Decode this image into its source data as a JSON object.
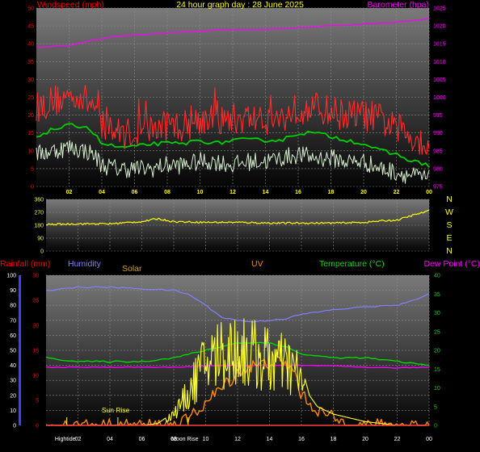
{
  "colors": {
    "wind": "#ff0000",
    "gust": "#ff2a2a",
    "avg": "#00d000",
    "speed": "#d8f0d0",
    "baro": "#ff00ff",
    "dir": "#ffff00",
    "rain": "#ff0000",
    "humidity": "#8080ff",
    "solar": "#ffff30",
    "uv": "#ff8800",
    "temp": "#00e000",
    "dew": "#ff00ff",
    "grid": "#8a8a8a",
    "white_label": "#ffffff",
    "bg_top": "#050505",
    "bg_bottom": "#7a7a7a"
  },
  "chart_data": [
    {
      "type": "line",
      "title": "24 hour graph day : 28 June 2025",
      "left_label": "Windspeed (mph)",
      "right_label": "Barometer (hpa)",
      "x_ticks": [
        "02",
        "04",
        "06",
        "08",
        "10",
        "12",
        "14",
        "16",
        "18",
        "20",
        "22",
        "00"
      ],
      "x_hours": [
        2,
        4,
        6,
        8,
        10,
        12,
        14,
        16,
        18,
        20,
        22,
        24
      ],
      "y_left_ticks": [
        "0",
        "5",
        "10",
        "15",
        "20",
        "25",
        "30",
        "35",
        "40",
        "45",
        "50"
      ],
      "y_left_lim": [
        0,
        50
      ],
      "y_right_ticks": [
        "975",
        "980",
        "985",
        "990",
        "995",
        "1000",
        "1005",
        "1010",
        "1015",
        "1020",
        "1025"
      ],
      "y_right_lim": [
        975,
        1025
      ],
      "series": [
        {
          "key": "gust",
          "x": [
            0,
            1,
            2,
            2.5,
            3,
            3.5,
            4,
            5,
            6,
            7,
            8,
            9,
            10,
            11,
            12,
            13,
            14,
            15,
            16,
            17,
            18,
            19,
            20,
            21,
            22,
            23,
            24
          ],
          "values": [
            22,
            24,
            25,
            26,
            24,
            23,
            17,
            15,
            15,
            16,
            17,
            17,
            19,
            18,
            19,
            19,
            19,
            19,
            22,
            22,
            21,
            20,
            20,
            19,
            16,
            14,
            12
          ]
        },
        {
          "key": "avg",
          "x": [
            0,
            1,
            2,
            3,
            3.5,
            4,
            5,
            6,
            7,
            8,
            9,
            10,
            11,
            12,
            13,
            14,
            15,
            16,
            17,
            18,
            19,
            20,
            21,
            22,
            23,
            24
          ],
          "values": [
            14,
            16,
            17,
            17,
            15,
            12,
            11,
            11,
            12,
            12,
            12,
            13,
            12,
            13,
            13,
            13,
            13,
            15,
            15,
            14,
            13,
            12,
            10,
            9,
            7,
            6
          ]
        },
        {
          "key": "speed",
          "x": [
            0,
            1,
            2,
            3,
            3.5,
            4,
            5,
            6,
            7,
            8,
            9,
            10,
            11,
            12,
            13,
            14,
            15,
            16,
            17,
            18,
            19,
            20,
            21,
            22,
            23,
            24
          ],
          "values": [
            9,
            10,
            11,
            10,
            9,
            6,
            5,
            5,
            5,
            6,
            6,
            7,
            7,
            6,
            7,
            7,
            8,
            9,
            8,
            8,
            7,
            7,
            5,
            4,
            3,
            2
          ]
        },
        {
          "key": "baro",
          "x": [
            0,
            2,
            3,
            4,
            6,
            8,
            10,
            12,
            14,
            16,
            18,
            20,
            22,
            24
          ],
          "values": [
            1014,
            1014.5,
            1015.5,
            1016.5,
            1017.5,
            1018,
            1018.5,
            1019,
            1019,
            1019.5,
            1020,
            1020.5,
            1021,
            1022
          ]
        }
      ]
    },
    {
      "type": "line",
      "right_label": "N W S E N",
      "compass": [
        "N",
        "W",
        "S",
        "E",
        "N"
      ],
      "y_ticks": [
        "0",
        "90",
        "180",
        "270",
        "360"
      ],
      "ylim": [
        0,
        360
      ],
      "series": [
        {
          "key": "dir",
          "x": [
            0,
            2,
            4,
            6,
            7,
            8,
            10,
            12,
            14,
            16,
            18,
            20,
            21,
            22,
            23,
            24
          ],
          "values": [
            185,
            190,
            190,
            205,
            225,
            205,
            200,
            200,
            195,
            195,
            195,
            200,
            210,
            215,
            250,
            280
          ]
        }
      ]
    },
    {
      "type": "line",
      "labels": {
        "rainfall": "Rainfall (mm)",
        "humidity": "Humidity",
        "solar": "Solar",
        "uv": "UV",
        "temperature": "Temperature (°C)",
        "dew": "Dew Point (°C)"
      },
      "x_ticks": [
        "02",
        "04",
        "06",
        "08",
        "10",
        "12",
        "14",
        "16",
        "18",
        "20",
        "22",
        "00"
      ],
      "y_humidity_ticks": [
        "0",
        "10",
        "20",
        "30",
        "40",
        "50",
        "60",
        "70",
        "80",
        "90",
        "100"
      ],
      "y_rain_ticks": [
        "0",
        "5",
        "10",
        "15",
        "20",
        "25",
        "30"
      ],
      "y_rain_lim": [
        0,
        30
      ],
      "y_temp_ticks": [
        "0",
        "5",
        "10",
        "15",
        "20",
        "25",
        "30",
        "35",
        "40"
      ],
      "y_temp_lim": [
        0,
        40
      ],
      "events": [
        {
          "label": "Sun Rise",
          "hour": 4.5
        },
        {
          "label": "Hightide",
          "hour": 1.3
        },
        {
          "label": "Moon Rise",
          "hour": 8.9
        }
      ],
      "series": [
        {
          "key": "humidity",
          "x": [
            0,
            2,
            4,
            6,
            8,
            9,
            10,
            11,
            12,
            13,
            14,
            15,
            16,
            18,
            20,
            22,
            23,
            24
          ],
          "values": [
            90,
            92,
            92,
            91,
            90,
            87,
            80,
            72,
            70,
            69,
            70,
            71,
            74,
            77,
            79,
            80,
            83,
            88
          ]
        },
        {
          "key": "temp",
          "x": [
            0,
            2,
            4,
            6,
            8,
            9,
            10,
            11,
            12,
            13,
            14,
            15,
            16,
            18,
            20,
            22,
            24
          ],
          "values": [
            18,
            17,
            17,
            17,
            18,
            19,
            20,
            21,
            22,
            22,
            22,
            21,
            19,
            18,
            18,
            17,
            16
          ]
        },
        {
          "key": "dew",
          "x": [
            0,
            2,
            4,
            6,
            8,
            10,
            12,
            14,
            16,
            18,
            20,
            22,
            24
          ],
          "values": [
            15.5,
            15.5,
            15.5,
            15.5,
            15.5,
            15.8,
            16,
            16,
            16,
            15.8,
            15.5,
            15.3,
            15.5
          ]
        },
        {
          "key": "solar",
          "x": [
            0,
            6,
            7,
            7.5,
            8,
            8.5,
            9,
            9.5,
            10,
            10.5,
            11,
            11.5,
            12,
            12.5,
            13,
            13.5,
            14,
            14.5,
            15,
            15.5,
            16,
            16.5,
            17,
            18,
            19,
            20,
            21,
            22,
            24
          ],
          "values": [
            0,
            0,
            0.5,
            2,
            4,
            8,
            12,
            18,
            22,
            24,
            26,
            26,
            27,
            26,
            25,
            24,
            23,
            22,
            21,
            20,
            16,
            8,
            5,
            3,
            2,
            1,
            0.5,
            0,
            0
          ]
        },
        {
          "key": "uv",
          "x": [
            0,
            8,
            8.5,
            9,
            9.5,
            10,
            10.5,
            11,
            11.5,
            12,
            12.5,
            13,
            13.5,
            14,
            14.5,
            15,
            15.5,
            16,
            17,
            18,
            18.5,
            19,
            24
          ],
          "values": [
            0,
            0,
            0.5,
            2,
            4,
            6,
            8,
            10,
            12,
            14,
            15,
            16,
            16,
            17,
            17,
            16,
            15,
            8,
            4,
            2,
            1,
            0,
            0
          ]
        }
      ]
    }
  ]
}
